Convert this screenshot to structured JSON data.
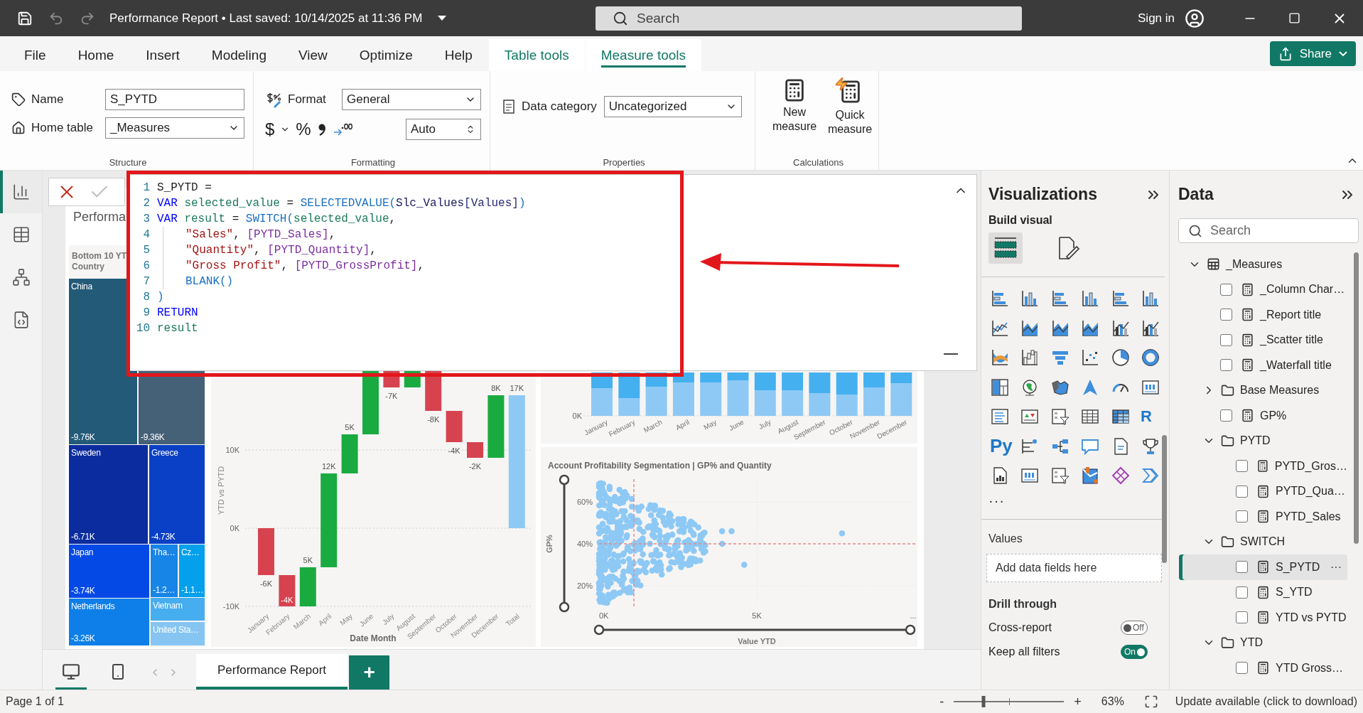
{
  "title_bar": {
    "title": "Performance Report • Last saved: 10/14/2025 at 11:36 PM",
    "search": {
      "placeholder": "Search"
    },
    "sign_in": "Sign in"
  },
  "ribbon_tabs": [
    {
      "label": "File",
      "kind": "plain",
      "selected": false
    },
    {
      "label": "Home",
      "kind": "plain",
      "selected": false
    },
    {
      "label": "Insert",
      "kind": "plain",
      "selected": false
    },
    {
      "label": "Modeling",
      "kind": "plain",
      "selected": false
    },
    {
      "label": "View",
      "kind": "plain",
      "selected": false
    },
    {
      "label": "Optimize",
      "kind": "plain",
      "selected": false
    },
    {
      "label": "Help",
      "kind": "plain",
      "selected": false
    },
    {
      "label": "Table tools",
      "kind": "contextual",
      "selected": false
    },
    {
      "label": "Measure tools",
      "kind": "contextual",
      "selected": true
    }
  ],
  "share_button": "Share",
  "ribbon": {
    "structure": {
      "label": "Structure",
      "name_label": "Name",
      "name_value": "S_PYTD",
      "home_table_label": "Home table",
      "home_table_value": "_Measures"
    },
    "formatting": {
      "label": "Formatting",
      "format_label": "Format",
      "format_value": "General",
      "currency": "$",
      "percent": "%",
      "decimals": "Auto"
    },
    "properties": {
      "label": "Properties",
      "data_category_label": "Data category",
      "data_category_value": "Uncategorized"
    },
    "calculations": {
      "label": "Calculations",
      "buttons": [
        {
          "label": "New measure",
          "kind": "new"
        },
        {
          "label": "Quick measure",
          "kind": "quick"
        }
      ]
    }
  },
  "nav": [
    {
      "kind": "report",
      "selected": true
    },
    {
      "kind": "table",
      "selected": false
    },
    {
      "kind": "model",
      "selected": false
    },
    {
      "kind": "dax",
      "selected": false
    }
  ],
  "formula_bar": {
    "lines": [
      {
        "number": "1",
        "indented": false,
        "tokens": [
          {
            "kind": "plain",
            "text": "S_PYTD ="
          }
        ]
      },
      {
        "number": "2",
        "indented": false,
        "tokens": [
          {
            "kind": "keyword",
            "text": "VAR"
          },
          {
            "kind": "variable",
            "text": " selected_value"
          },
          {
            "kind": "plain",
            "text": " = "
          },
          {
            "kind": "function",
            "text": "SELECTEDVALUE("
          },
          {
            "kind": "table",
            "text": "Slc_Values"
          },
          {
            "kind": "column",
            "text": "[Values]"
          },
          {
            "kind": "function",
            "text": ")"
          }
        ]
      },
      {
        "number": "3",
        "indented": false,
        "tokens": [
          {
            "kind": "keyword",
            "text": "VAR"
          },
          {
            "kind": "variable",
            "text": " result"
          },
          {
            "kind": "plain",
            "text": " = "
          },
          {
            "kind": "function",
            "text": "SWITCH("
          },
          {
            "kind": "variable",
            "text": "selected_value"
          },
          {
            "kind": "plain",
            "text": ","
          }
        ]
      },
      {
        "number": "4",
        "indented": true,
        "tokens": [
          {
            "kind": "string",
            "text": "\"Sales\""
          },
          {
            "kind": "plain",
            "text": ", "
          },
          {
            "kind": "measure",
            "text": "[PYTD_Sales]"
          },
          {
            "kind": "plain",
            "text": ","
          }
        ]
      },
      {
        "number": "5",
        "indented": true,
        "tokens": [
          {
            "kind": "string",
            "text": "\"Quantity\""
          },
          {
            "kind": "plain",
            "text": ", "
          },
          {
            "kind": "measure",
            "text": "[PYTD_Quantity]"
          },
          {
            "kind": "plain",
            "text": ","
          }
        ]
      },
      {
        "number": "6",
        "indented": true,
        "tokens": [
          {
            "kind": "string",
            "text": "\"Gross Profit\""
          },
          {
            "kind": "plain",
            "text": ", "
          },
          {
            "kind": "measure",
            "text": "[PYTD_GrossProfit]"
          },
          {
            "kind": "plain",
            "text": ","
          }
        ]
      },
      {
        "number": "7",
        "indented": true,
        "tokens": [
          {
            "kind": "function",
            "text": "BLANK()"
          }
        ]
      },
      {
        "number": "8",
        "indented": false,
        "tokens": [
          {
            "kind": "function",
            "text": ")"
          }
        ]
      },
      {
        "number": "9",
        "indented": false,
        "tokens": [
          {
            "kind": "keyword",
            "text": "RETURN"
          }
        ]
      },
      {
        "number": "10",
        "indented": false,
        "tokens": [
          {
            "kind": "variable",
            "text": "result"
          }
        ]
      }
    ]
  },
  "report": {
    "title": "Performa",
    "treemap": {
      "title": "Bottom 10 YT",
      "subtitle": "Country",
      "tiles": [
        {
          "name": "China",
          "value": "-9.76K",
          "color": "#235a78"
        },
        {
          "value": "-9.36K",
          "color": "#456178"
        },
        {
          "name": "Sweden",
          "value": "-6.71K",
          "color": "#0b2c9e"
        },
        {
          "name": "Greece",
          "value": "-4.73K",
          "color": "#0a40c6"
        },
        {
          "name": "Japan",
          "value": "-3.74K",
          "color": "#0449e6"
        },
        {
          "name": "Tha…",
          "value": "-1.2…",
          "color": "#1784e8"
        },
        {
          "name": "Cz…",
          "value": "-1.1…",
          "color": "#05a0ec"
        },
        {
          "name": "Netherlands",
          "value": "-3.26K",
          "color": "#0e7fe8"
        },
        {
          "name": "Vietnam",
          "color": "#46adef"
        },
        {
          "name": "United Sta…",
          "color": "#86c5f2"
        }
      ]
    },
    "waterfall": {
      "xlabel": "Date Month",
      "ylabel": "YTD vs PYTD",
      "yticks": [
        "10K",
        "0K",
        "-10K"
      ],
      "categories": [
        "January",
        "February",
        "March",
        "April",
        "May",
        "June",
        "July",
        "August",
        "September",
        "October",
        "November",
        "December",
        "Total"
      ],
      "data_labels": [
        "-6K",
        "-4K",
        "5K",
        "12K",
        "5K",
        "-7K",
        "-8K",
        "-4K",
        "-2K",
        "8K",
        "17K"
      ]
    },
    "column_chart": {
      "axis_label": "0K",
      "categories": [
        "January",
        "February",
        "March",
        "April",
        "May",
        "June",
        "July",
        "August",
        "September",
        "October",
        "November",
        "December"
      ]
    },
    "scatter": {
      "title": "Account Profitability Segmentation | GP% and Quantity",
      "ylabel": "GP%",
      "xlabel": "Value YTD",
      "yticks": [
        "60%",
        "40%",
        "20%"
      ],
      "xticks": [
        "0K",
        "5K",
        "..."
      ],
      "y_slider": {
        "level": 1
      },
      "x_slider": {
        "level": 1
      }
    }
  },
  "page_tabs": {
    "views": [
      {
        "kind": "desktop",
        "selected": true
      },
      {
        "kind": "phone",
        "selected": false
      }
    ],
    "tabs": [
      {
        "label": "Performance Report",
        "selected": true
      }
    ],
    "add_label": "+"
  },
  "visualizations": {
    "title": "Visualizations",
    "build_label": "Build visual",
    "modes": [
      {
        "kind": "build",
        "selected": true
      },
      {
        "kind": "format",
        "selected": false
      }
    ],
    "visual_types": [
      {
        "kind": "hbar"
      },
      {
        "kind": "vbar"
      },
      {
        "kind": "hbar"
      },
      {
        "kind": "vbar"
      },
      {
        "kind": "hbar"
      },
      {
        "kind": "vbar"
      },
      {
        "kind": "line"
      },
      {
        "kind": "area"
      },
      {
        "kind": "area"
      },
      {
        "kind": "area"
      },
      {
        "kind": "combo"
      },
      {
        "kind": "combo"
      },
      {
        "kind": "ribbon"
      },
      {
        "kind": "waterfall"
      },
      {
        "kind": "funnel"
      },
      {
        "kind": "scatter"
      },
      {
        "kind": "pie"
      },
      {
        "kind": "donut"
      },
      {
        "kind": "treemap"
      },
      {
        "kind": "globe"
      },
      {
        "kind": "map"
      },
      {
        "kind": "arrow"
      },
      {
        "kind": "gauge"
      },
      {
        "kind": "card"
      },
      {
        "kind": "list"
      },
      {
        "kind": "kpi"
      },
      {
        "kind": "slicer"
      },
      {
        "kind": "table"
      },
      {
        "kind": "matrix"
      },
      {
        "kind": "letter",
        "label": "R"
      },
      {
        "kind": "letter",
        "label": "Py"
      },
      {
        "kind": "influencers"
      },
      {
        "kind": "tree"
      },
      {
        "kind": "speech"
      },
      {
        "kind": "doc"
      },
      {
        "kind": "trophy"
      },
      {
        "kind": "paginated"
      },
      {
        "kind": "card"
      },
      {
        "kind": "slicer"
      },
      {
        "kind": "azuremap"
      },
      {
        "kind": "diamond"
      },
      {
        "kind": "chevron"
      }
    ],
    "more": "···",
    "values_label": "Values",
    "drop_placeholder": "Add data fields here",
    "drill_title": "Drill through",
    "toggles": [
      {
        "label": "Cross-report",
        "on": false,
        "state": "Off"
      },
      {
        "label": "Keep all filters",
        "on": true,
        "state": "On"
      }
    ]
  },
  "data_pane": {
    "title": "Data",
    "search": {
      "placeholder": "Search"
    },
    "tree": [
      {
        "label": "_Measures",
        "kind": "table",
        "expanded": true,
        "selected": false,
        "children": [
          {
            "label": "_Column Char…",
            "kind": "measure",
            "checked": false,
            "selected": false
          },
          {
            "label": "_Report title",
            "kind": "measure",
            "checked": false,
            "selected": false
          },
          {
            "label": "_Scatter title",
            "kind": "measure",
            "checked": false,
            "selected": false
          },
          {
            "label": "_Waterfall title",
            "kind": "measure",
            "checked": false,
            "selected": false
          },
          {
            "label": "Base Measures",
            "kind": "folder",
            "expanded": false,
            "selected": false
          },
          {
            "label": "GP%",
            "kind": "measure",
            "checked": false,
            "selected": false
          },
          {
            "label": "PYTD",
            "kind": "folder",
            "expanded": true,
            "selected": false,
            "children": [
              {
                "label": "PYTD_Gros…",
                "kind": "measure",
                "checked": false,
                "selected": false
              },
              {
                "label": "PYTD_Qua…",
                "kind": "measure",
                "checked": false,
                "selected": false
              },
              {
                "label": "PYTD_Sales",
                "kind": "measure",
                "checked": false,
                "selected": false
              }
            ]
          },
          {
            "label": "SWITCH",
            "kind": "folder",
            "expanded": true,
            "selected": false,
            "children": [
              {
                "label": "S_PYTD",
                "kind": "measure",
                "checked": false,
                "selected": true,
                "more": "···"
              },
              {
                "label": "S_YTD",
                "kind": "measure",
                "checked": false,
                "selected": false
              },
              {
                "label": "YTD vs PYTD",
                "kind": "measure",
                "checked": false,
                "selected": false
              }
            ]
          },
          {
            "label": "YTD",
            "kind": "folder",
            "expanded": true,
            "selected": false,
            "children": [
              {
                "label": "YTD Gross…",
                "kind": "measure",
                "checked": false,
                "selected": false
              }
            ]
          }
        ]
      }
    ]
  },
  "status_bar": {
    "page": "Page 1 of 1",
    "zoom": {
      "minus": "-",
      "plus": "+",
      "level": 0.27,
      "reading": "63%"
    },
    "update": "Update available (click to download)"
  }
}
